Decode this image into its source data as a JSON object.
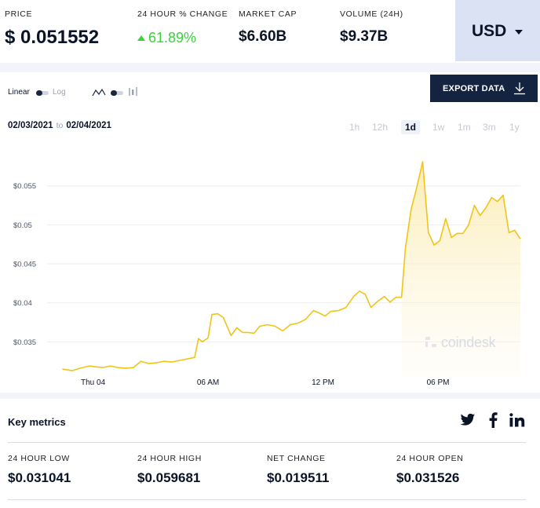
{
  "stats": [
    {
      "label": "PRICE",
      "value": "$ 0.051552"
    },
    {
      "label": "24 HOUR % CHANGE",
      "value": "61.89%"
    },
    {
      "label": "MARKET CAP",
      "value": "$6.60B"
    },
    {
      "label": "VOLUME (24H)",
      "value": "$9.37B"
    }
  ],
  "currency": {
    "label": "USD"
  },
  "controls": {
    "linear": "Linear",
    "log": "Log",
    "export_label": "EXPORT DATA"
  },
  "date_range": {
    "from": "02/03/2021",
    "to_word": "to",
    "to": "02/04/2021"
  },
  "range_tabs": [
    "1h",
    "12h",
    "1d",
    "1w",
    "1m",
    "3m",
    "1y"
  ],
  "active_range": "1d",
  "watermark": "coindesk",
  "colors": {
    "line": "#f0c419",
    "fill": "#fdf3cf",
    "accent_green": "#3bd23d",
    "navy": "#14233f"
  },
  "chart_data": {
    "type": "area",
    "title": "",
    "xlabel": "",
    "ylabel": "",
    "x_ticks": [
      "Thu 04",
      "06 AM",
      "12 PM",
      "06 PM"
    ],
    "y_ticks": [
      "$0.035",
      "$0.04",
      "$0.045",
      "$0.05",
      "$0.055"
    ],
    "y_tick_values": [
      0.035,
      0.04,
      0.045,
      0.05,
      0.055
    ],
    "ylim": [
      0.0305,
      0.0587
    ],
    "xlim_hours": [
      -2.4,
      22.3
    ],
    "x_unit": "hours from Thu 04 00:00",
    "grid": true,
    "series": [
      {
        "values": [
          [
            -1.6,
            0.0315
          ],
          [
            -1.1,
            0.0313
          ],
          [
            -0.7,
            0.0316
          ],
          [
            -0.2,
            0.0319
          ],
          [
            0.1,
            0.0318
          ],
          [
            0.5,
            0.0317
          ],
          [
            0.9,
            0.0319
          ],
          [
            1.3,
            0.0317
          ],
          [
            1.7,
            0.0316
          ],
          [
            2.1,
            0.0317
          ],
          [
            2.5,
            0.0325
          ],
          [
            2.9,
            0.0322
          ],
          [
            3.3,
            0.0323
          ],
          [
            3.7,
            0.0325
          ],
          [
            4.1,
            0.0324
          ],
          [
            4.5,
            0.0326
          ],
          [
            4.9,
            0.0328
          ],
          [
            5.3,
            0.033
          ],
          [
            5.5,
            0.0354
          ],
          [
            5.7,
            0.035
          ],
          [
            6.0,
            0.0355
          ],
          [
            6.2,
            0.0385
          ],
          [
            6.5,
            0.0386
          ],
          [
            6.8,
            0.0381
          ],
          [
            7.2,
            0.0358
          ],
          [
            7.5,
            0.0368
          ],
          [
            7.8,
            0.0362
          ],
          [
            8.1,
            0.0362
          ],
          [
            8.4,
            0.0361
          ],
          [
            8.7,
            0.037
          ],
          [
            9.1,
            0.0372
          ],
          [
            9.5,
            0.037
          ],
          [
            9.9,
            0.0364
          ],
          [
            10.3,
            0.0372
          ],
          [
            10.7,
            0.0374
          ],
          [
            11.1,
            0.0379
          ],
          [
            11.5,
            0.039
          ],
          [
            11.8,
            0.0387
          ],
          [
            12.1,
            0.0383
          ],
          [
            12.4,
            0.0389
          ],
          [
            12.8,
            0.039
          ],
          [
            13.2,
            0.0394
          ],
          [
            13.6,
            0.0408
          ],
          [
            13.9,
            0.0415
          ],
          [
            14.2,
            0.0411
          ],
          [
            14.5,
            0.0394
          ],
          [
            14.8,
            0.0401
          ],
          [
            15.2,
            0.0408
          ],
          [
            15.5,
            0.0401
          ],
          [
            15.8,
            0.0407
          ],
          [
            16.1,
            0.0407
          ],
          [
            16.3,
            0.047
          ],
          [
            16.6,
            0.052
          ],
          [
            16.9,
            0.0549
          ],
          [
            17.2,
            0.0581
          ],
          [
            17.5,
            0.049
          ],
          [
            17.8,
            0.0474
          ],
          [
            18.1,
            0.048
          ],
          [
            18.4,
            0.0508
          ],
          [
            18.7,
            0.0484
          ],
          [
            19.0,
            0.0489
          ],
          [
            19.3,
            0.0489
          ],
          [
            19.6,
            0.05
          ],
          [
            19.9,
            0.0525
          ],
          [
            20.2,
            0.0512
          ],
          [
            20.5,
            0.0522
          ],
          [
            20.8,
            0.0535
          ],
          [
            21.1,
            0.053
          ],
          [
            21.4,
            0.0538
          ],
          [
            21.7,
            0.049
          ],
          [
            22.0,
            0.0493
          ],
          [
            22.3,
            0.0482
          ]
        ]
      }
    ]
  },
  "key_metrics": {
    "title": "Key metrics",
    "items": [
      {
        "label": "24 HOUR LOW",
        "value": "$0.031041"
      },
      {
        "label": "24 HOUR HIGH",
        "value": "$0.059681"
      },
      {
        "label": "NET CHANGE",
        "value": "$0.019511"
      },
      {
        "label": "24 HOUR OPEN",
        "value": "$0.031526"
      }
    ]
  },
  "social": [
    "twitter-icon",
    "facebook-icon",
    "linkedin-icon"
  ]
}
